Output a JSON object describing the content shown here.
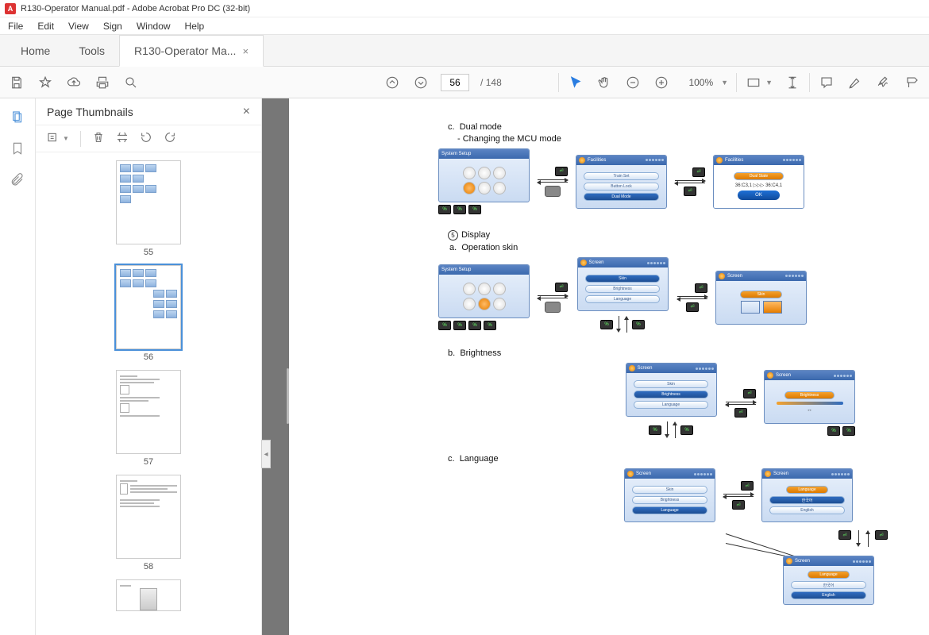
{
  "window": {
    "title": "R130-Operator Manual.pdf - Adobe Acrobat Pro DC (32-bit)"
  },
  "menu": {
    "file": "File",
    "edit": "Edit",
    "view": "View",
    "sign": "Sign",
    "window": "Window",
    "help": "Help"
  },
  "tabs": {
    "home": "Home",
    "tools": "Tools",
    "doc": "R130-Operator Ma..."
  },
  "toolbar": {
    "page_current": "56",
    "page_total": "148",
    "zoom": "100%"
  },
  "panel": {
    "title": "Page Thumbnails",
    "p55": "55",
    "p56": "56",
    "p57": "57",
    "p58": "58"
  },
  "doc": {
    "c_label": "c.",
    "dual_mode": "Dual mode",
    "dual_sub": "- Changing the MCU mode",
    "disp_num": "5",
    "disp_title": "Display",
    "a_label": "a.",
    "op_skin": "Operation skin",
    "b_label": "b.",
    "brightness": "Brightness",
    "c2_label": "c.",
    "language": "Language",
    "screens": {
      "system_setup": "System Setup",
      "facilities": "Facilities",
      "screen": "Screen",
      "train_set": "Train Set",
      "button_lock": "Button Lock",
      "dual_mode_bar": "Dual Mode",
      "skin": "Skin",
      "brightness_bar": "Brightness",
      "language_bar": "Language",
      "ok": "OK",
      "dual_code": "36:C3,1 ▷▷▷ 36:C4,1",
      "lang_kr": "한국어",
      "lang_en": "English"
    }
  }
}
